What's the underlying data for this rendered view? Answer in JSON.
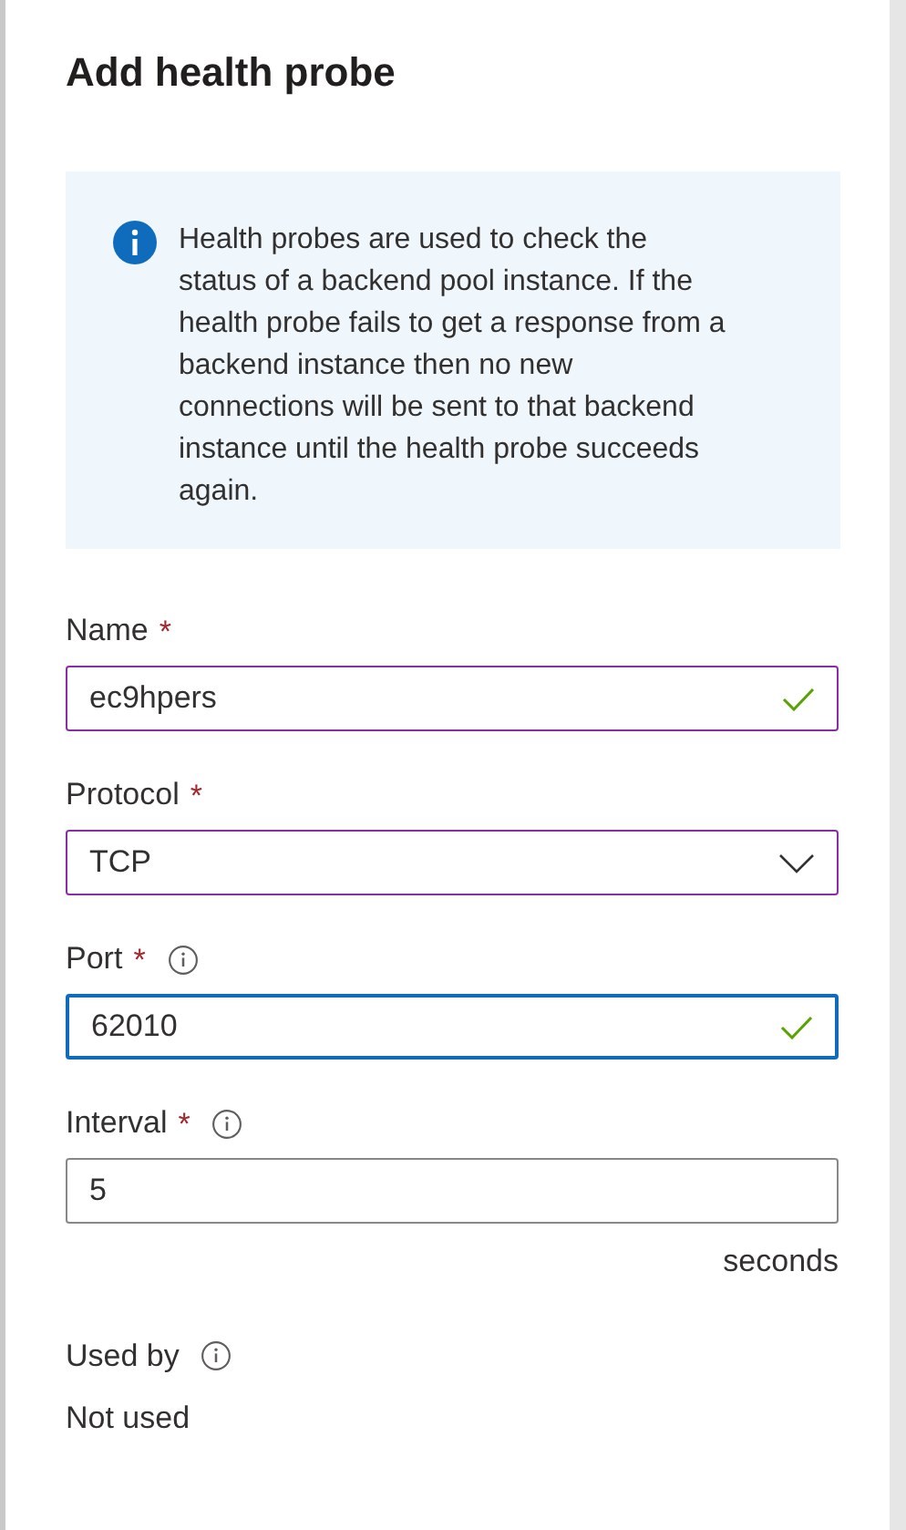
{
  "panel": {
    "title": "Add health probe"
  },
  "info_box": {
    "text": "Health probes are used to check the status of a backend pool instance. If the health probe fails to get a response from a backend instance then no new connections will be sent to that backend instance until the health probe succeeds again."
  },
  "fields": [
    {
      "kind": "text",
      "label": "Name",
      "required_mark": "*",
      "info": false,
      "value": "ec9hpers",
      "valid": true,
      "modified": true,
      "focused": false
    },
    {
      "kind": "select",
      "label": "Protocol",
      "required_mark": "*",
      "info": false,
      "value": "TCP",
      "modified": true,
      "focused": false
    },
    {
      "kind": "text",
      "label": "Port",
      "required_mark": "*",
      "info": true,
      "value": "62010",
      "valid": true,
      "focused": true
    },
    {
      "kind": "text",
      "label": "Interval",
      "required_mark": "*",
      "info": true,
      "value": "5",
      "valid": false,
      "modified": false,
      "focused": false,
      "suffix": "seconds"
    }
  ],
  "used_by": {
    "label": "Used by",
    "info": true,
    "value": "Not used"
  }
}
